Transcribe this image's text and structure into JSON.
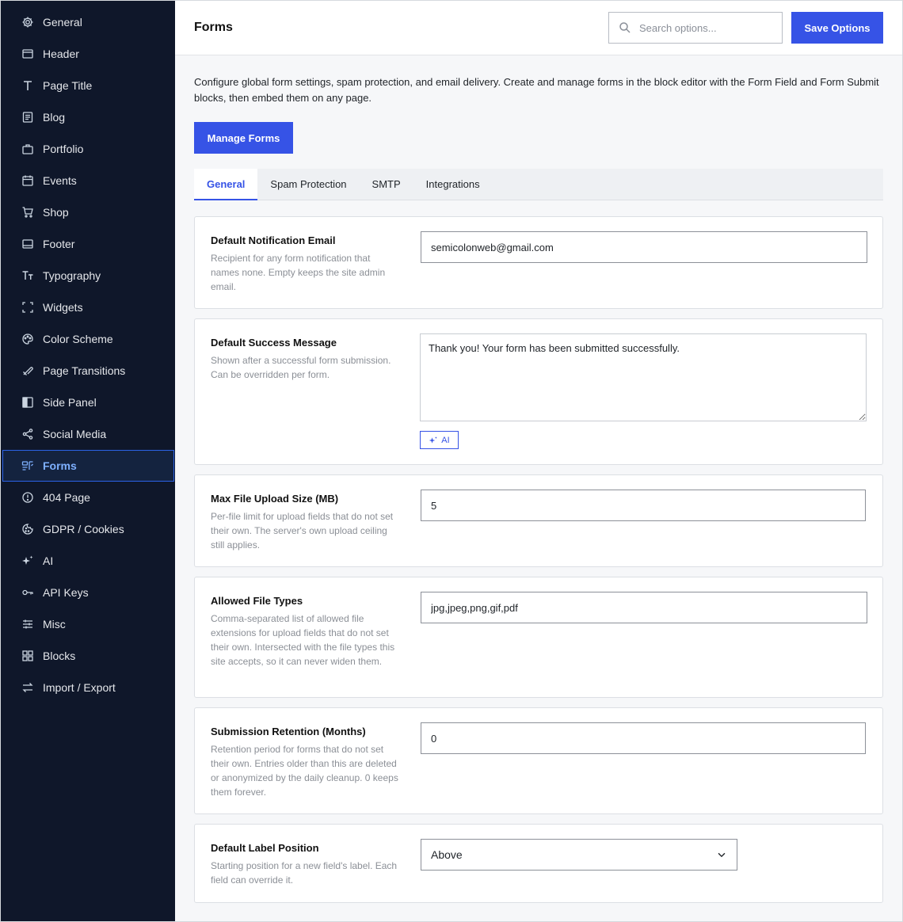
{
  "sidebar": {
    "items": [
      {
        "label": "General",
        "icon": "gear-icon"
      },
      {
        "label": "Header",
        "icon": "header-icon"
      },
      {
        "label": "Page Title",
        "icon": "title-icon"
      },
      {
        "label": "Blog",
        "icon": "blog-icon"
      },
      {
        "label": "Portfolio",
        "icon": "briefcase-icon"
      },
      {
        "label": "Events",
        "icon": "calendar-icon"
      },
      {
        "label": "Shop",
        "icon": "cart-icon"
      },
      {
        "label": "Footer",
        "icon": "footer-icon"
      },
      {
        "label": "Typography",
        "icon": "typography-icon"
      },
      {
        "label": "Widgets",
        "icon": "widgets-icon"
      },
      {
        "label": "Color Scheme",
        "icon": "palette-icon"
      },
      {
        "label": "Page Transitions",
        "icon": "transitions-icon"
      },
      {
        "label": "Side Panel",
        "icon": "side-panel-icon"
      },
      {
        "label": "Social Media",
        "icon": "share-icon"
      },
      {
        "label": "Forms",
        "icon": "forms-icon",
        "active": true
      },
      {
        "label": "404 Page",
        "icon": "alert-circle-icon"
      },
      {
        "label": "GDPR / Cookies",
        "icon": "cookie-icon"
      },
      {
        "label": "AI",
        "icon": "sparkle-icon"
      },
      {
        "label": "API Keys",
        "icon": "key-icon"
      },
      {
        "label": "Misc",
        "icon": "sliders-icon"
      },
      {
        "label": "Blocks",
        "icon": "blocks-icon"
      },
      {
        "label": "Import / Export",
        "icon": "swap-icon"
      }
    ]
  },
  "header": {
    "title": "Forms",
    "search_placeholder": "Search options...",
    "save_label": "Save Options"
  },
  "intro": "Configure global form settings, spam protection, and email delivery. Create and manage forms in the block editor with the Form Field and Form Submit blocks, then embed them on any page.",
  "manage_label": "Manage Forms",
  "tabs": [
    {
      "label": "General",
      "active": true
    },
    {
      "label": "Spam Protection"
    },
    {
      "label": "SMTP"
    },
    {
      "label": "Integrations"
    }
  ],
  "fields": {
    "notify_email": {
      "title": "Default Notification Email",
      "desc": "Recipient for any form notification that names none. Empty keeps the site admin email.",
      "value": "semicolonweb@gmail.com"
    },
    "success_message": {
      "title": "Default Success Message",
      "desc": "Shown after a successful form submission. Can be overridden per form.",
      "value": "Thank you! Your form has been submitted successfully.",
      "ai_label": "AI"
    },
    "max_upload": {
      "title": "Max File Upload Size (MB)",
      "desc": "Per-file limit for upload fields that do not set their own. The server's own upload ceiling still applies.",
      "value": "5"
    },
    "file_types": {
      "title": "Allowed File Types",
      "desc": "Comma-separated list of allowed file extensions for upload fields that do not set their own. Intersected with the file types this site accepts, so it can never widen them.",
      "value": "jpg,jpeg,png,gif,pdf"
    },
    "retention": {
      "title": "Submission Retention (Months)",
      "desc": "Retention period for forms that do not set their own. Entries older than this are deleted or anonymized by the daily cleanup. 0 keeps them forever.",
      "value": "0"
    },
    "label_position": {
      "title": "Default Label Position",
      "desc": "Starting position for a new field's label. Each field can override it.",
      "value": "Above"
    }
  },
  "colors": {
    "sidebar_bg": "#0f172a",
    "accent": "#3653e6",
    "active_text": "#7eb0ff"
  }
}
